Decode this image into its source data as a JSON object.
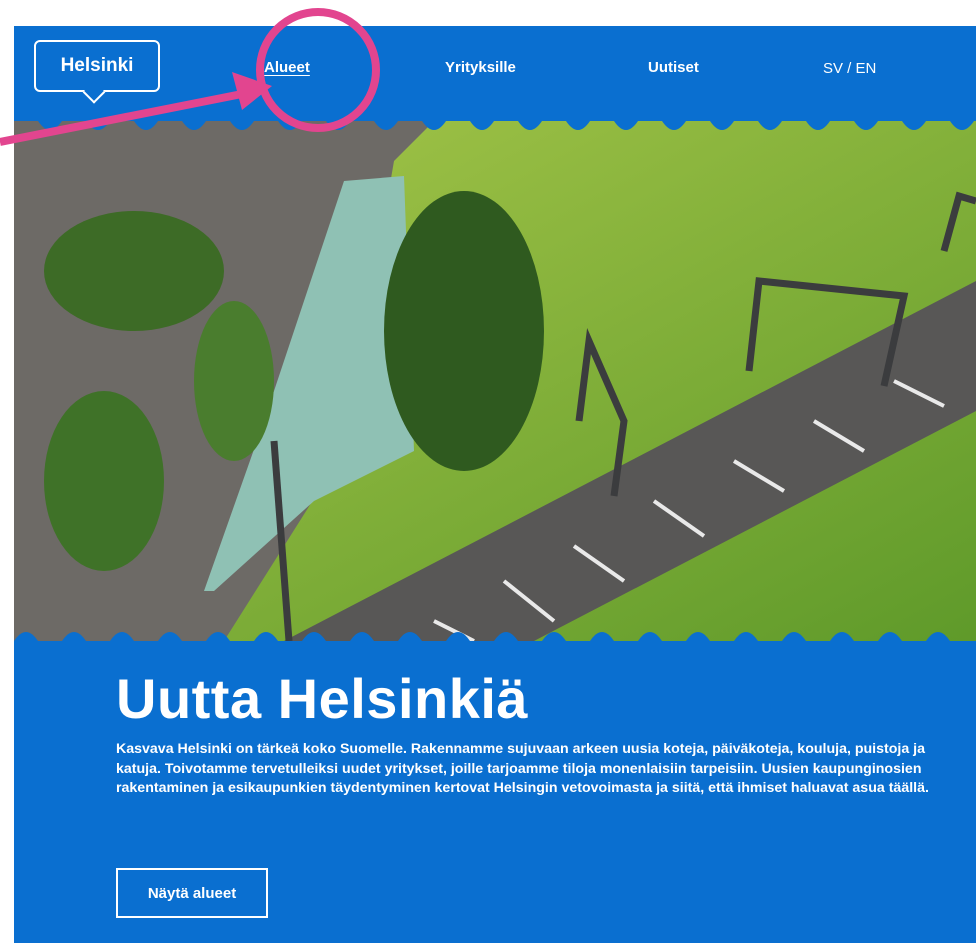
{
  "header": {
    "logo_text": "Helsinki",
    "nav": [
      {
        "label": "Alueet",
        "active": true
      },
      {
        "label": "Yrityksille",
        "active": false
      },
      {
        "label": "Uutiset",
        "active": false
      }
    ],
    "lang_switch": "SV / EN"
  },
  "hero": {
    "title": "Uutta Helsinkiä",
    "text": "Kasvava Helsinki on tärkeä koko Suomelle. Rakennamme sujuvaan arkeen uusia koteja, päiväkoteja, kouluja, puistoja ja katuja. Toivotamme tervetulleiksi uudet yritykset, joille tarjoamme tiloja monenlaisiin tarpeisiin. Uusien kaupunginosien rakentaminen ja esikaupunkien täydentyminen kertovat Helsingin vetovoimasta ja siitä, että ihmiset haluavat asua täällä.",
    "button": "Näytä alueet"
  },
  "colors": {
    "brand_blue": "#0a6fd0",
    "annotation_pink": "#e2458f",
    "white": "#ffffff"
  },
  "icons": {
    "annotation": "highlight-circle-and-arrow"
  }
}
